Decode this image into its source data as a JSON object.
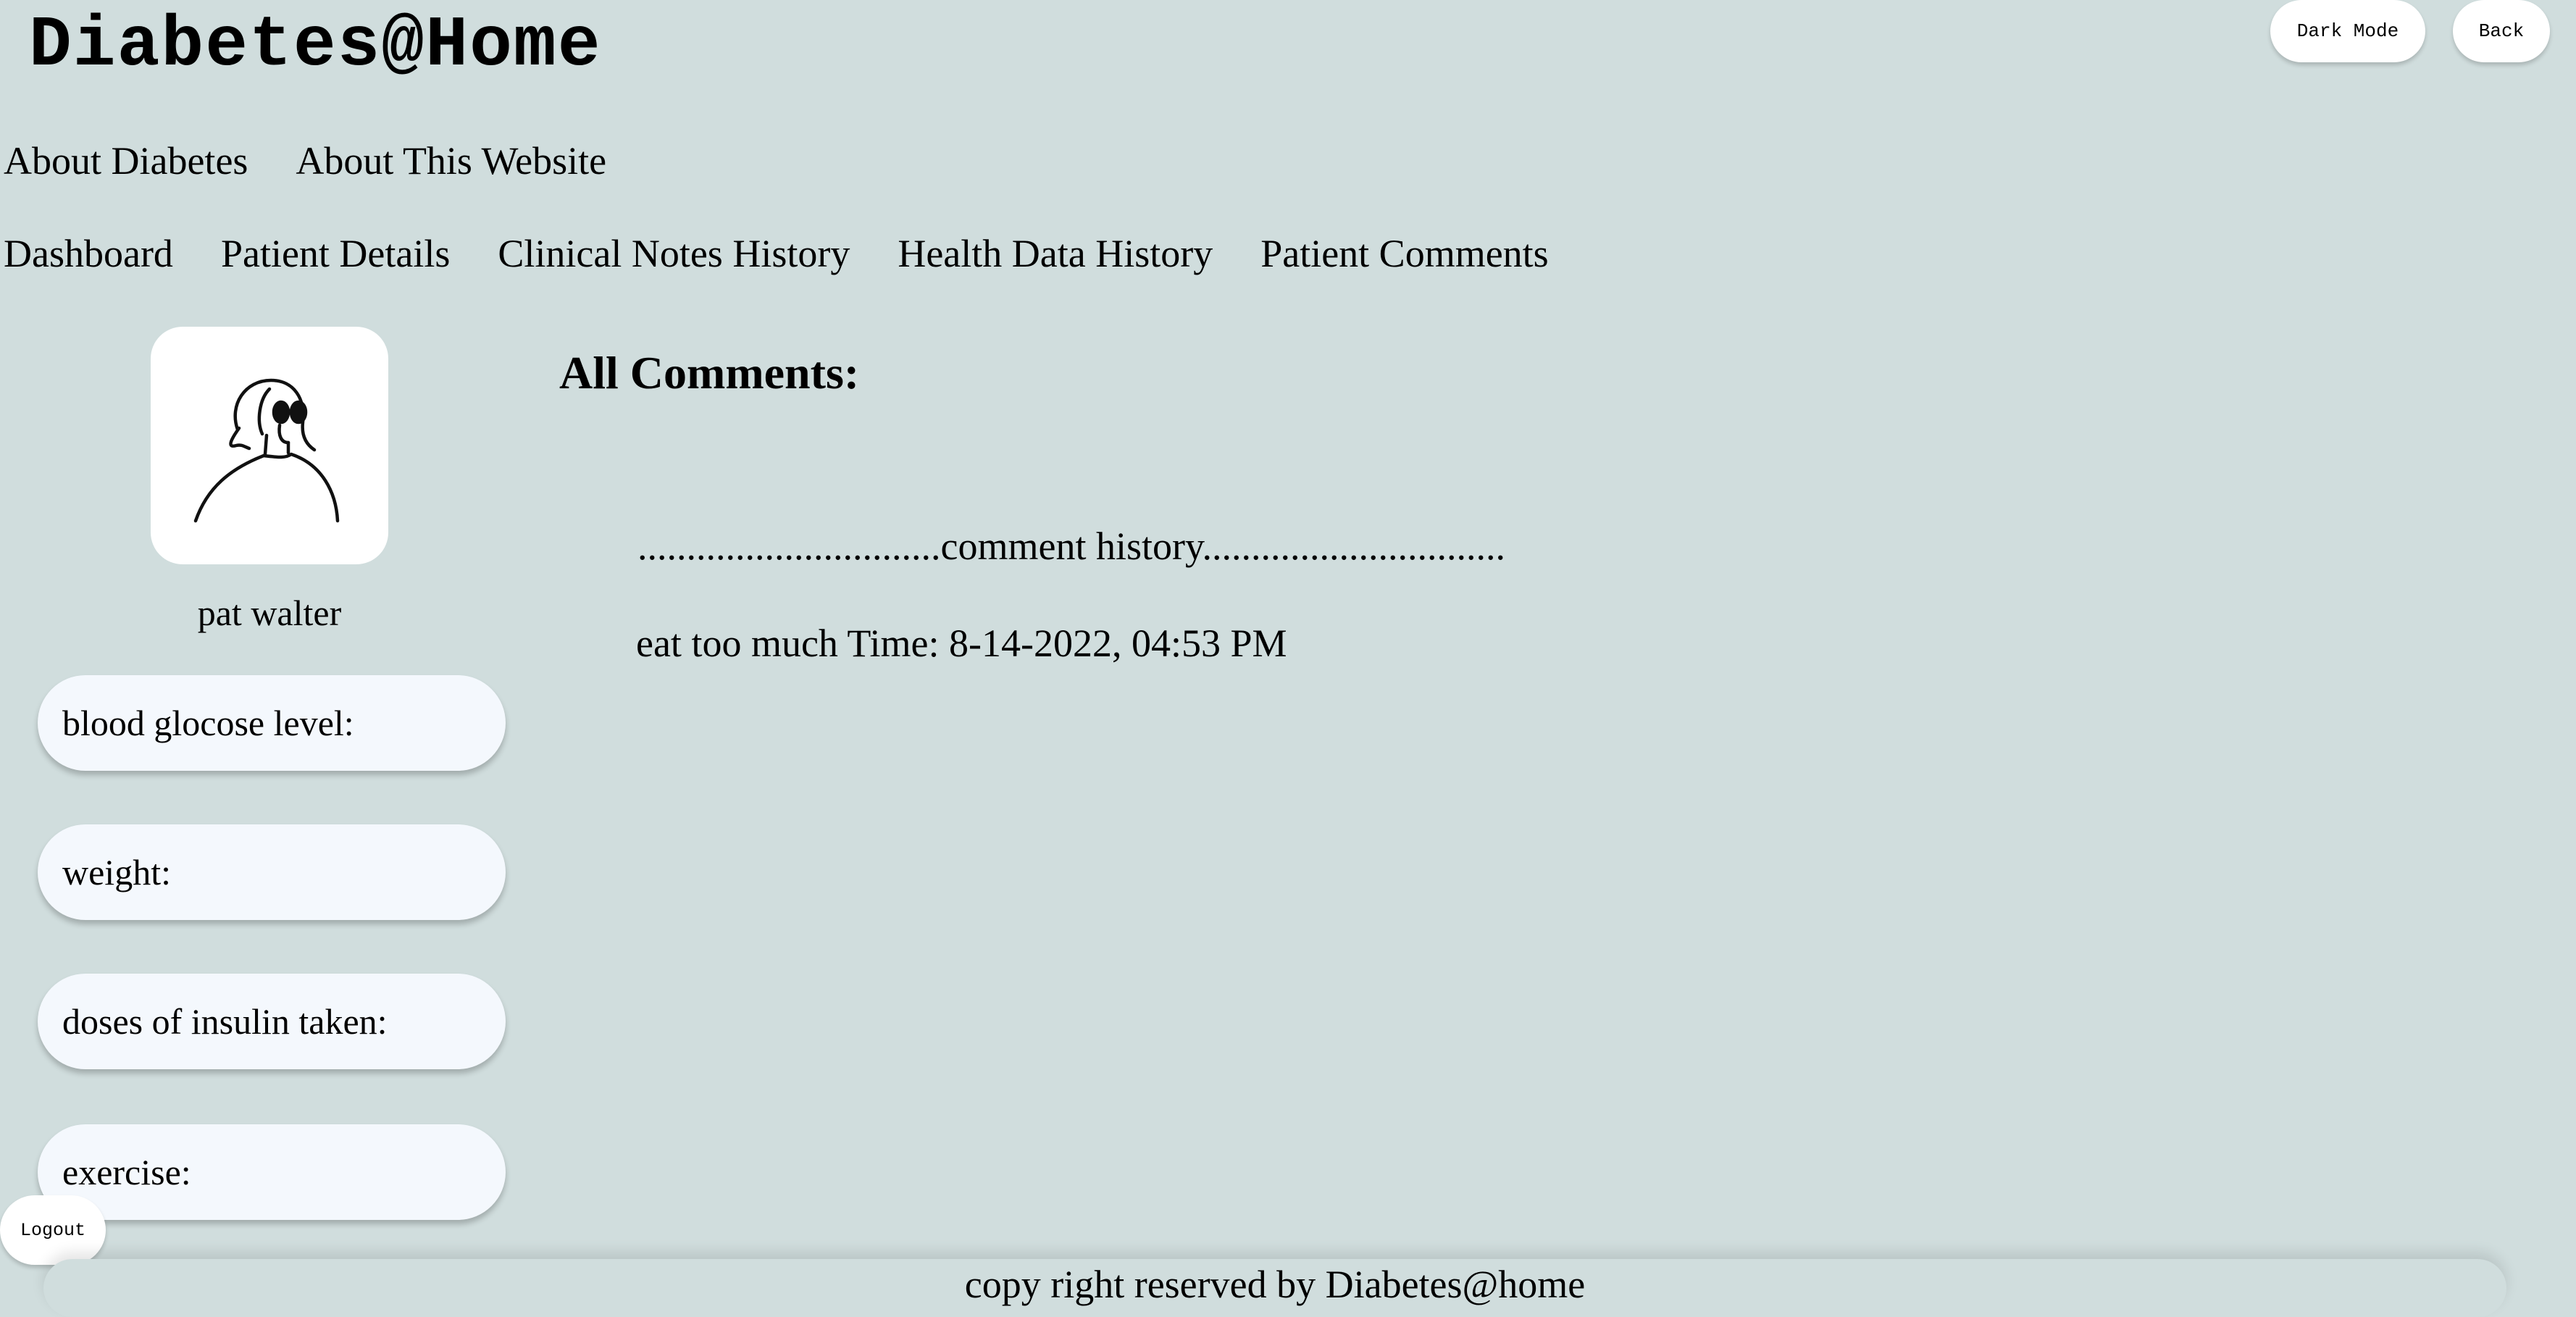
{
  "header": {
    "title": "Diabetes@Home",
    "dark_mode_label": "Dark Mode",
    "back_label": "Back"
  },
  "nav_top": [
    "About Diabetes",
    "About This Website"
  ],
  "nav_main": [
    "Dashboard",
    "Patient Details",
    "Clinical Notes History",
    "Health Data History",
    "Patient Comments"
  ],
  "patient": {
    "name": "pat walter",
    "avatar_icon": "person-avatar-icon"
  },
  "stats": {
    "glucose_label": "blood glocose level:",
    "weight_label": "weight:",
    "insulin_label": "doses of insulin taken:",
    "exercise_label": "exercise:"
  },
  "comments": {
    "title": "All Comments:",
    "history_heading": "...............................comment history...............................",
    "entries": [
      "eat too much Time: 8-14-2022, 04:53 PM"
    ]
  },
  "logout_label": "Logout",
  "footer_text": "copy right reserved by Diabetes@home",
  "colors": {
    "background": "#d0dddd",
    "card": "#f4f8fd",
    "button": "#ffffff"
  }
}
